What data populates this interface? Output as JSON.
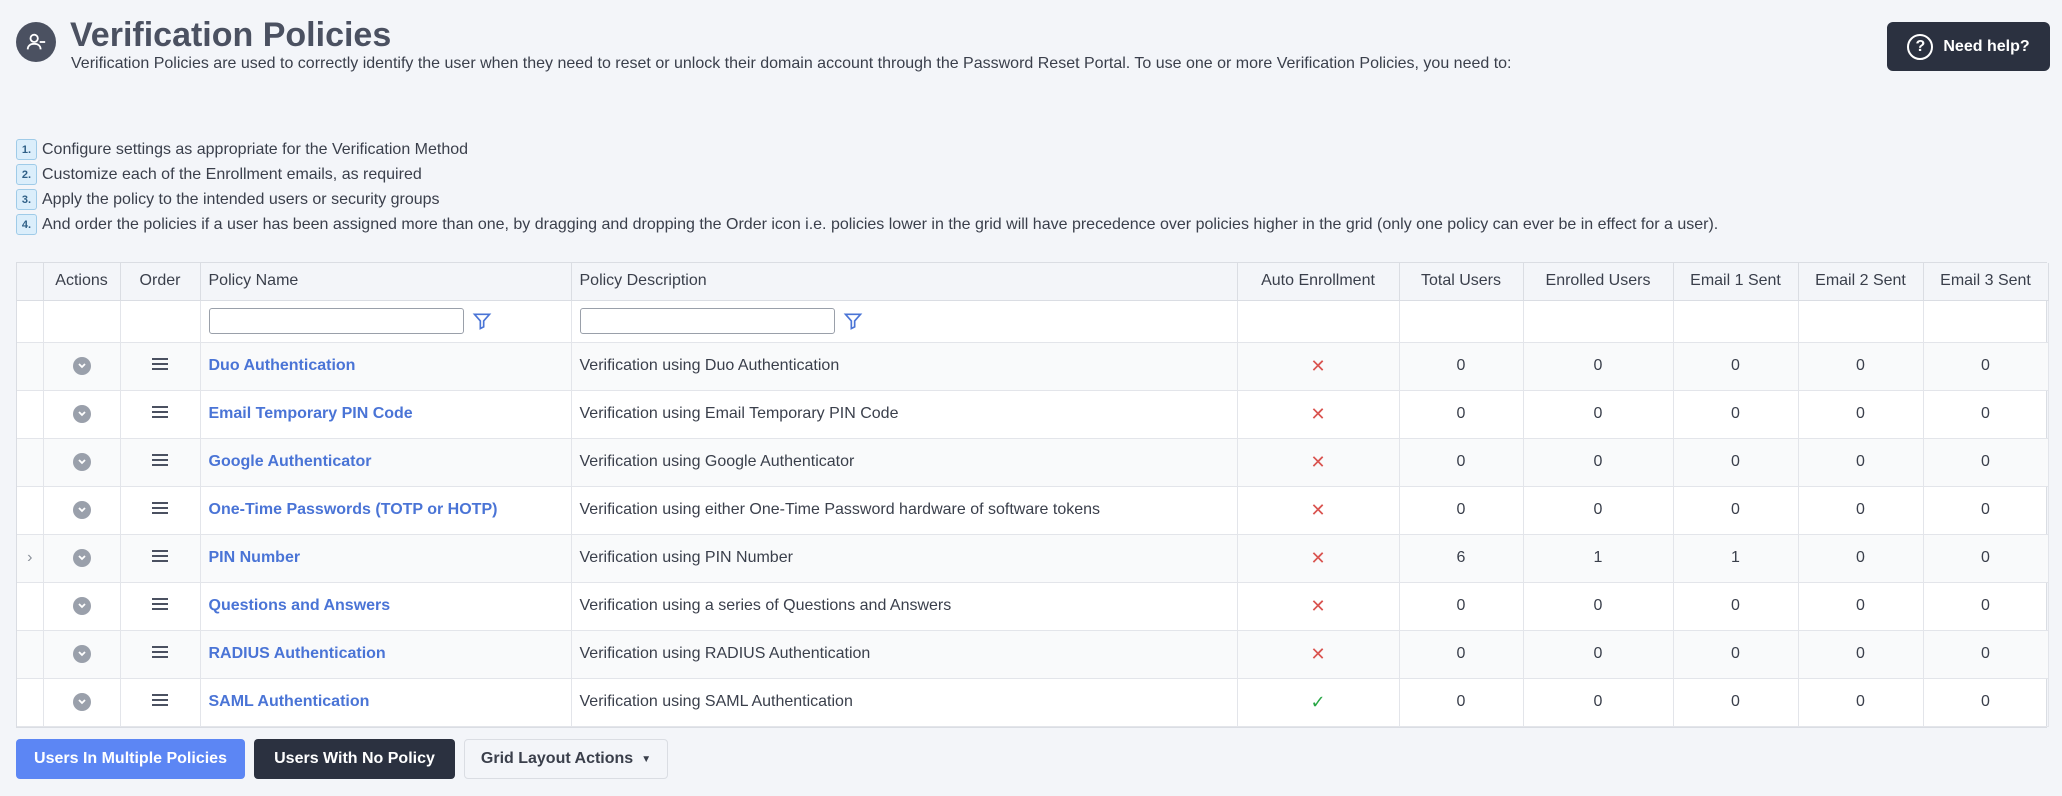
{
  "page": {
    "title": "Verification Policies",
    "description": "Verification Policies are used to correctly identify the user when they need to reset or unlock their domain account through the Password Reset Portal. To use one or more Verification Policies, you need to:",
    "help_label": "Need help?"
  },
  "steps": [
    {
      "num": "1.",
      "text": "Configure settings as appropriate for the Verification Method"
    },
    {
      "num": "2.",
      "text": "Customize each of the Enrollment emails, as required"
    },
    {
      "num": "3.",
      "text": "Apply the policy to the intended users or security groups"
    },
    {
      "num": "4.",
      "text": "And order the policies if a user has been assigned more than one, by dragging and dropping the Order icon i.e. policies lower in the grid will have precedence over policies higher in the grid (only one policy can ever be in effect for a user)."
    }
  ],
  "grid": {
    "columns": {
      "actions": "Actions",
      "order": "Order",
      "name": "Policy Name",
      "description": "Policy Description",
      "auto": "Auto Enrollment",
      "total": "Total Users",
      "enrolled": "Enrolled Users",
      "email1": "Email 1 Sent",
      "email2": "Email 2 Sent",
      "email3": "Email 3 Sent"
    },
    "rows": [
      {
        "name": "Duo Authentication",
        "description": "Verification using Duo Authentication",
        "auto": "✕",
        "total": "0",
        "enrolled": "0",
        "email1": "0",
        "email2": "0",
        "email3": "0"
      },
      {
        "name": "Email Temporary PIN Code",
        "description": "Verification using Email Temporary PIN Code",
        "auto": "✕",
        "total": "0",
        "enrolled": "0",
        "email1": "0",
        "email2": "0",
        "email3": "0"
      },
      {
        "name": "Google Authenticator",
        "description": "Verification using Google Authenticator",
        "auto": "✕",
        "total": "0",
        "enrolled": "0",
        "email1": "0",
        "email2": "0",
        "email3": "0"
      },
      {
        "name": "One-Time Passwords (TOTP or HOTP)",
        "description": "Verification using either One-Time Password hardware of software tokens",
        "auto": "✕",
        "total": "0",
        "enrolled": "0",
        "email1": "0",
        "email2": "0",
        "email3": "0"
      },
      {
        "name": "PIN Number",
        "description": "Verification using PIN Number",
        "auto": "✕",
        "total": "6",
        "enrolled": "1",
        "email1": "1",
        "email2": "0",
        "email3": "0"
      },
      {
        "name": "Questions and Answers",
        "description": "Verification using a series of Questions and Answers",
        "auto": "✕",
        "total": "0",
        "enrolled": "0",
        "email1": "0",
        "email2": "0",
        "email3": "0"
      },
      {
        "name": "RADIUS Authentication",
        "description": "Verification using RADIUS Authentication",
        "auto": "✕",
        "total": "0",
        "enrolled": "0",
        "email1": "0",
        "email2": "0",
        "email3": "0"
      },
      {
        "name": "SAML Authentication",
        "description": "Verification using SAML Authentication",
        "auto": "✓",
        "total": "0",
        "enrolled": "0",
        "email1": "0",
        "email2": "0",
        "email3": "0"
      }
    ]
  },
  "buttons": {
    "multi": "Users In Multiple Policies",
    "nopolicy": "Users With No Policy",
    "grid_layout": "Grid Layout Actions"
  },
  "icons": {
    "header": "user-minus-icon",
    "help": "question-circle-icon",
    "filter": "funnel-icon",
    "action": "chevron-down-circle-icon",
    "order": "drag-handle-icon",
    "expand": "chevron-right-icon"
  },
  "colors": {
    "accent": "#5c86f4",
    "dark": "#2b3140",
    "link": "#4a74d6",
    "cross": "#d9534f",
    "check": "#28a745"
  }
}
